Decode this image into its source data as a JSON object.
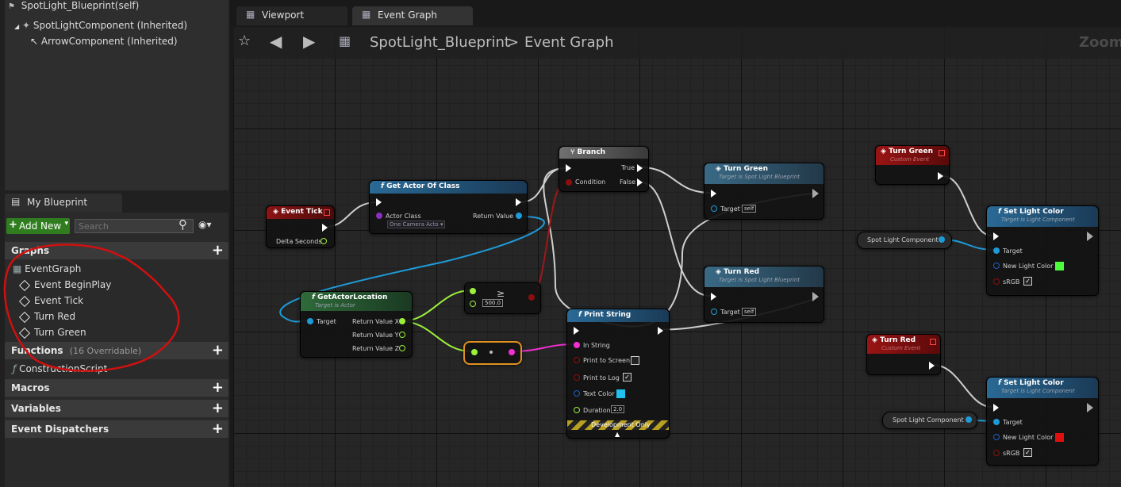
{
  "component_tree": {
    "root": "SpotLight_Blueprint(self)",
    "child1": "SpotLightComponent (Inherited)",
    "child2": "ArrowComponent (Inherited)"
  },
  "my_blueprint": {
    "tab_label": "My Blueprint",
    "add_new_label": "Add New",
    "search_placeholder": "Search",
    "sections": {
      "graphs": "Graphs",
      "functions": "Functions",
      "functions_count": "(16 Overridable)",
      "macros": "Macros",
      "variables": "Variables",
      "event_dispatchers": "Event Dispatchers"
    },
    "graph_items": {
      "event_graph": "EventGraph",
      "begin_play": "Event BeginPlay",
      "tick": "Event Tick",
      "turn_red": "Turn Red",
      "turn_green": "Turn Green"
    },
    "construction_script": "ConstructionScript"
  },
  "tabs": {
    "viewport": "Viewport",
    "event_graph": "Event Graph"
  },
  "breadcrumb": {
    "blueprint": "SpotLight_Blueprint",
    "separator": ">",
    "graph": "Event Graph",
    "zoom_label": "Zoom"
  },
  "nodes": {
    "event_tick": {
      "title": "Event Tick",
      "delta": "Delta Seconds"
    },
    "get_actor_of_class": {
      "title": "Get Actor Of Class",
      "actor_class": "Actor Class",
      "class_value": "One Camera Acto",
      "return_value": "Return Value"
    },
    "get_actor_location": {
      "title": "GetActorLocation",
      "subtitle": "Target is Actor",
      "target": "Target",
      "rx": "Return Value X",
      "ry": "Return Value Y",
      "rz": "Return Value Z"
    },
    "compare": {
      "value": "500.0"
    },
    "branch": {
      "title": "Branch",
      "condition": "Condition",
      "true_label": "True",
      "false_label": "False"
    },
    "print_string": {
      "title": "Print String",
      "in_string": "In String",
      "print_screen": "Print to Screen",
      "print_log": "Print to Log",
      "text_color": "Text Color",
      "duration": "Duration",
      "duration_value": "2.0",
      "dev_only": "Development Only"
    },
    "turn_green_call": {
      "title": "Turn Green",
      "subtitle": "Target is Spot Light Blueprint",
      "target": "Target",
      "self": "self"
    },
    "turn_red_call": {
      "title": "Turn Red",
      "subtitle": "Target is Spot Light Blueprint",
      "target": "Target",
      "self": "self"
    },
    "turn_green_event": {
      "title": "Turn Green",
      "subtitle": "Custom Event"
    },
    "turn_red_event": {
      "title": "Turn Red",
      "subtitle": "Custom Event"
    },
    "spot_light_component": "Spot Light Component",
    "set_color_green": {
      "title": "Set Light Color",
      "subtitle": "Target is Light Component",
      "target": "Target",
      "new_color": "New Light Color",
      "srgb": "sRGB",
      "color": "#4cff3c"
    },
    "set_color_red": {
      "title": "Set Light Color",
      "subtitle": "Target is Light Component",
      "target": "Target",
      "new_color": "New Light Color",
      "srgb": "sRGB",
      "color": "#e01010"
    }
  },
  "colors": {
    "exec_wire": "#cfcfcf",
    "object_pin": "#1e9bd7",
    "float_pin": "#9cf03b",
    "string_pin": "#f030d0",
    "bool_pin": "#8e0e0e",
    "annotation": "#d01010"
  }
}
